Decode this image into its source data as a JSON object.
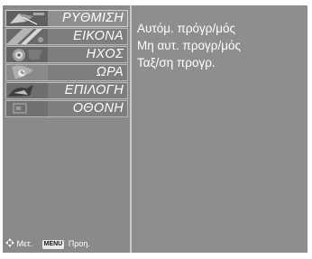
{
  "menu": {
    "items": [
      {
        "label": "ΡΥΘΜΙΣΗ",
        "thumb": "satellite-dish-icon",
        "selected": true
      },
      {
        "label": "ΕΙΚΟΝΑ",
        "thumb": "picture-thumbnail-icon",
        "selected": false
      },
      {
        "label": "ΗΧΟΣ",
        "thumb": "speaker-icon",
        "selected": false
      },
      {
        "label": "ΩΡΑ",
        "thumb": "clock-icon",
        "selected": false
      },
      {
        "label": "ΕΠΙΛΟΓΗ",
        "thumb": "option-thumbnail-icon",
        "selected": false
      },
      {
        "label": "ΟΘΟΝΗ",
        "thumb": "screen-thumbnail-icon",
        "selected": false
      }
    ]
  },
  "submenu": {
    "items": [
      "Αυτόμ. πρόγρ/μός",
      "Μη αυτ. προγρ/μός",
      "Ταξ/ση προγρ."
    ]
  },
  "footer": {
    "move_label": "Μετ.",
    "menu_key": "MENU",
    "prev_label": "Προη."
  },
  "colors": {
    "panel": "#8e8e8e",
    "text": "#ffffff"
  }
}
